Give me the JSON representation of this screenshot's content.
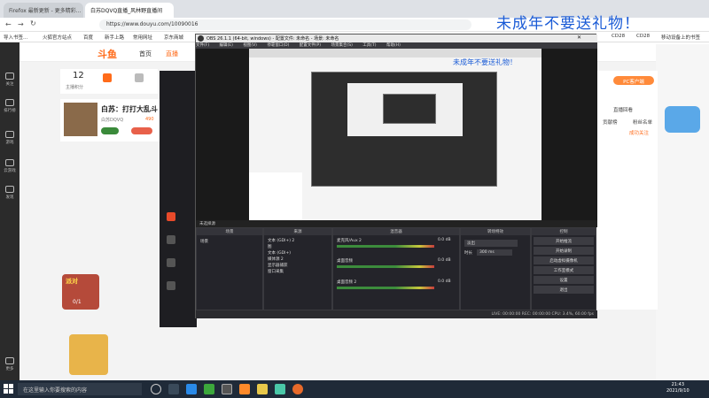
{
  "browser": {
    "tabs": [
      "Firefox 最新更新 - 更多精彩...",
      "白苏DQVQ直播_风林野直播间",
      ""
    ],
    "url": "https://www.douyu.com/10090016",
    "bookmarks": [
      "导入书签...",
      "火狐官方站点",
      "百度",
      "新手上路",
      "常用网址",
      "京东商城",
      "CD28",
      "CD28",
      "移动设备上的书签"
    ]
  },
  "douyu": {
    "logo": "斗鱼",
    "nav": [
      "首页",
      "直播"
    ],
    "left_nav": [
      "关注",
      "排行榜",
      "游戏",
      "云游戏",
      "发现",
      "更多"
    ],
    "stats": [
      {
        "value": "12",
        "label": "主播积分"
      }
    ],
    "streamer_title": "白苏：打打大乱斗",
    "streamer_id": "白苏DQVQ",
    "streamer_hot": "490",
    "right_btn": "PC客户端",
    "right_text": "直播回看",
    "right_items": [
      "贡献榜",
      "粉丝名单",
      "成功关注"
    ],
    "promo": "派对",
    "promo_count": "0/1"
  },
  "obs": {
    "title": "OBS 26.1.1 (64-bit, windows) - 配置文件: 未命名 - 场景: 未命名",
    "menu": [
      "文件(F)",
      "编辑(E)",
      "视图(V)",
      "停靠窗口(D)",
      "配置文件(P)",
      "场景集合(S)",
      "工具(T)",
      "帮助(H)"
    ],
    "preview_watermark": "未成年不要送礼物！",
    "sources_header": "未选择源",
    "docks": {
      "scenes": "场景",
      "sources": "来源",
      "mixer": "混音器",
      "transitions": "转场特效",
      "controls": "控制"
    },
    "scenes": [
      "场景"
    ],
    "sources": [
      "文本 (GDI+) 2",
      "图",
      "文本 (GDI+)",
      "媒体源 2",
      "显示器捕获",
      "窗口采集"
    ],
    "mixer": [
      {
        "name": "麦克风/Aux 2",
        "db": "0.0 dB"
      },
      {
        "name": "桌面音频",
        "db": "0.0 dB"
      },
      {
        "name": "桌面音频 2",
        "db": "0.0 dB"
      }
    ],
    "transition": {
      "type": "淡出",
      "duration_label": "时长",
      "duration": "300 ms"
    },
    "controls": [
      "开始推流",
      "开始录制",
      "启动虚拟摄像机",
      "工作室模式",
      "设置",
      "退出"
    ],
    "status": "LIVE: 00:00:00   REC: 00:00:00   CPU: 3.4%, 60.00 fps"
  },
  "watermark": "未成年不要送礼物！",
  "taskbar": {
    "search_placeholder": "在这里输入你要搜索的内容",
    "time": "21:43",
    "date": "2021/9/10"
  },
  "colors": {
    "accent": "#1a5bd6",
    "douyu_orange": "#ff6b1a",
    "obs_bg": "#2b2b2f"
  }
}
